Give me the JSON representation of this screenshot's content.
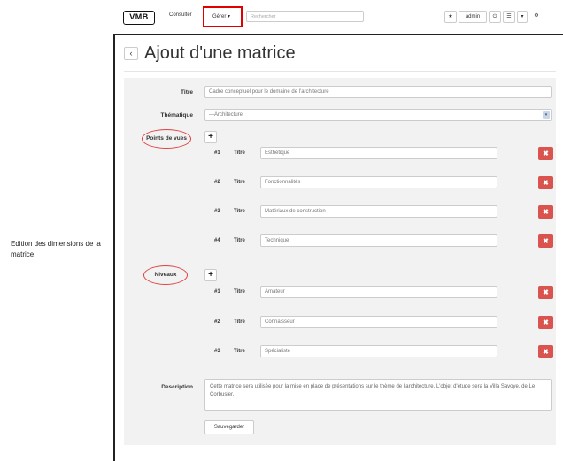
{
  "annotation": {
    "text": "Edition des dimensions de la matrice"
  },
  "navbar": {
    "logo": "VMB",
    "consulter": "Consulter",
    "gerer": "Gérer ▾",
    "search_placeholder": "Rechercher",
    "star": "★",
    "user": "admin",
    "power": "⏻",
    "menu": "☰",
    "caret": "▾",
    "gear": "⚙"
  },
  "page": {
    "back": "‹",
    "title": "Ajout d'une matrice"
  },
  "form": {
    "titre_label": "Titre",
    "titre_value": "Cadre conceptuel pour le domaine de l'architecture",
    "thematique_label": "Thématique",
    "thematique_value": "—Architecture",
    "points_label": "Points de vues",
    "niveaux_label": "Niveaux",
    "item_title_label": "Titre",
    "plus": "+",
    "delete": "✖",
    "points": [
      {
        "num": "#1",
        "value": "Esthétique"
      },
      {
        "num": "#2",
        "value": "Fonctionnalités"
      },
      {
        "num": "#3",
        "value": "Matériaux de construction"
      },
      {
        "num": "#4",
        "value": "Technique"
      }
    ],
    "niveaux": [
      {
        "num": "#1",
        "value": "Amateur"
      },
      {
        "num": "#2",
        "value": "Connaisseur"
      },
      {
        "num": "#3",
        "value": "Spécialiste"
      }
    ],
    "description_label": "Description",
    "description_value": "Cette matrice sera utilisée pour la mise en place de présentations sur le thème de l'architecture. L'objet d'étude sera la Villa Savoye, de Le Corbusier.",
    "save_label": "Sauvegarder"
  }
}
